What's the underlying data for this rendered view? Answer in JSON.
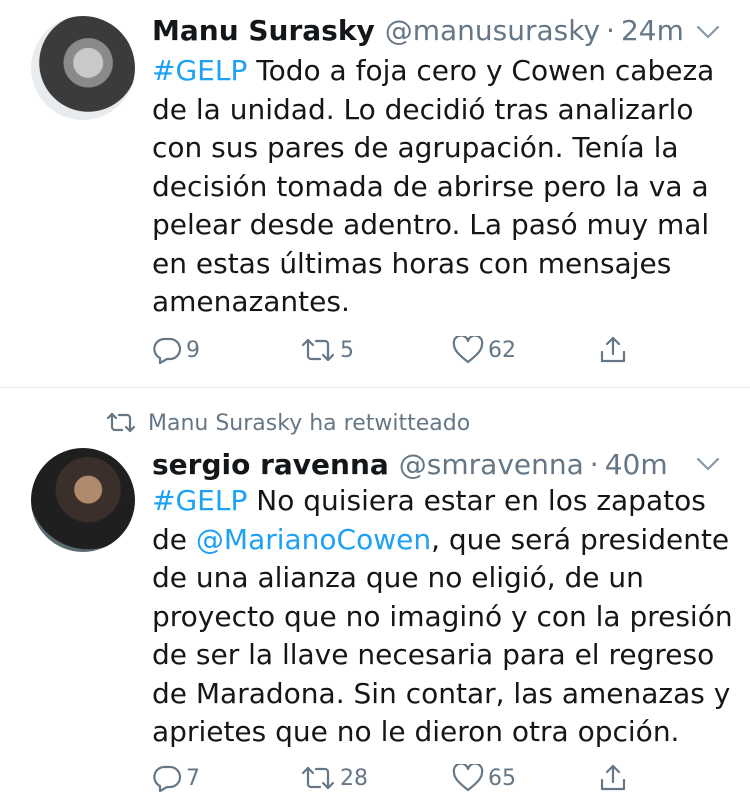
{
  "tweets": [
    {
      "name": "Manu Surasky",
      "handle": "@manusurasky",
      "separator": "·",
      "time": "24m",
      "hashtag": "#GELP",
      "lines": [
        " Todo a foja cero y Cowen cabeza",
        "de la unidad. Lo decidió tras analizarlo",
        "con sus pares de agrupación. Tenía la",
        "decisión tomada de abrirse pero la va a",
        "pelear desde adentro. La pasó muy mal",
        "en estas últimas horas con mensajes",
        "amenazantes."
      ],
      "replies": "9",
      "retweets": "5",
      "likes": "62"
    },
    {
      "retweeted_by": "Manu Surasky ha retwitteado",
      "name": "sergio ravenna",
      "handle": "@smravenna",
      "separator": "·",
      "time": "40m",
      "hashtag": "#GELP",
      "line1_rest": " No quisiera estar en los zapatos",
      "line2_pre": "de ",
      "mention": "@MarianoCowen",
      "line2_post": ", que será presidente",
      "lines": [
        "de una alianza que no eligió, de un",
        "proyecto que no imaginó y con la presión",
        "de ser la llave necesaria para el regreso",
        "de Maradona. Sin contar, las amenazas y",
        "aprietes que no le dieron otra opción."
      ],
      "replies": "7",
      "retweets": "28",
      "likes": "65"
    }
  ],
  "icons": {
    "reply": "reply-icon",
    "retweet": "retweet-icon",
    "like": "heart-icon",
    "share": "share-icon",
    "menu": "chevron-down-icon"
  },
  "colors": {
    "link": "#1da1f2",
    "secondary_text": "#657786",
    "divider": "#e1e8ed"
  }
}
